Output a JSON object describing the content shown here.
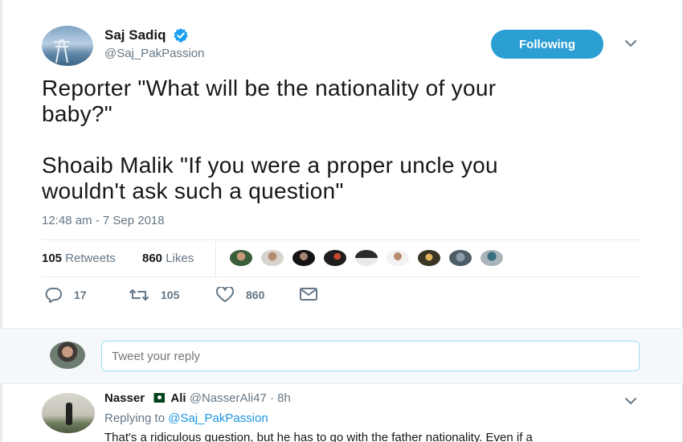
{
  "tweet": {
    "author": {
      "display_name": "Saj Sadiq",
      "handle": "@Saj_PakPassion",
      "verified": true
    },
    "follow_button_label": "Following",
    "text": "Reporter \"What will be the nationality of your\nbaby?\"\n\nShoaib Malik \"If you were a proper uncle you\nwouldn't ask such a question\"",
    "timestamp": "12:48 am - 7 Sep 2018",
    "stats": {
      "retweets_count": "105",
      "retweets_label": "Retweets",
      "likes_count": "860",
      "likes_label": "Likes"
    },
    "actions": {
      "reply_count": "17",
      "retweet_count": "105",
      "like_count": "860"
    }
  },
  "composer": {
    "placeholder": "Tweet your reply"
  },
  "reply": {
    "name_first": "Nasser",
    "name_second": "Ali",
    "handle": "@NasserAli47",
    "separator": "·",
    "time": "8h",
    "replying_label": "Replying to",
    "replying_to": "@Saj_PakPassion",
    "text": "That's a ridiculous question, but he has to go with the father nationality. Even if a"
  },
  "colors": {
    "accent": "#2b9ed4",
    "link": "#1b95e0",
    "muted": "#657786",
    "border": "#e6ecf0"
  },
  "icons": {
    "verified": "verified-badge-icon",
    "caret": "chevron-down-icon",
    "reply": "reply-icon",
    "retweet": "retweet-icon",
    "like": "heart-icon",
    "dm": "envelope-icon"
  }
}
